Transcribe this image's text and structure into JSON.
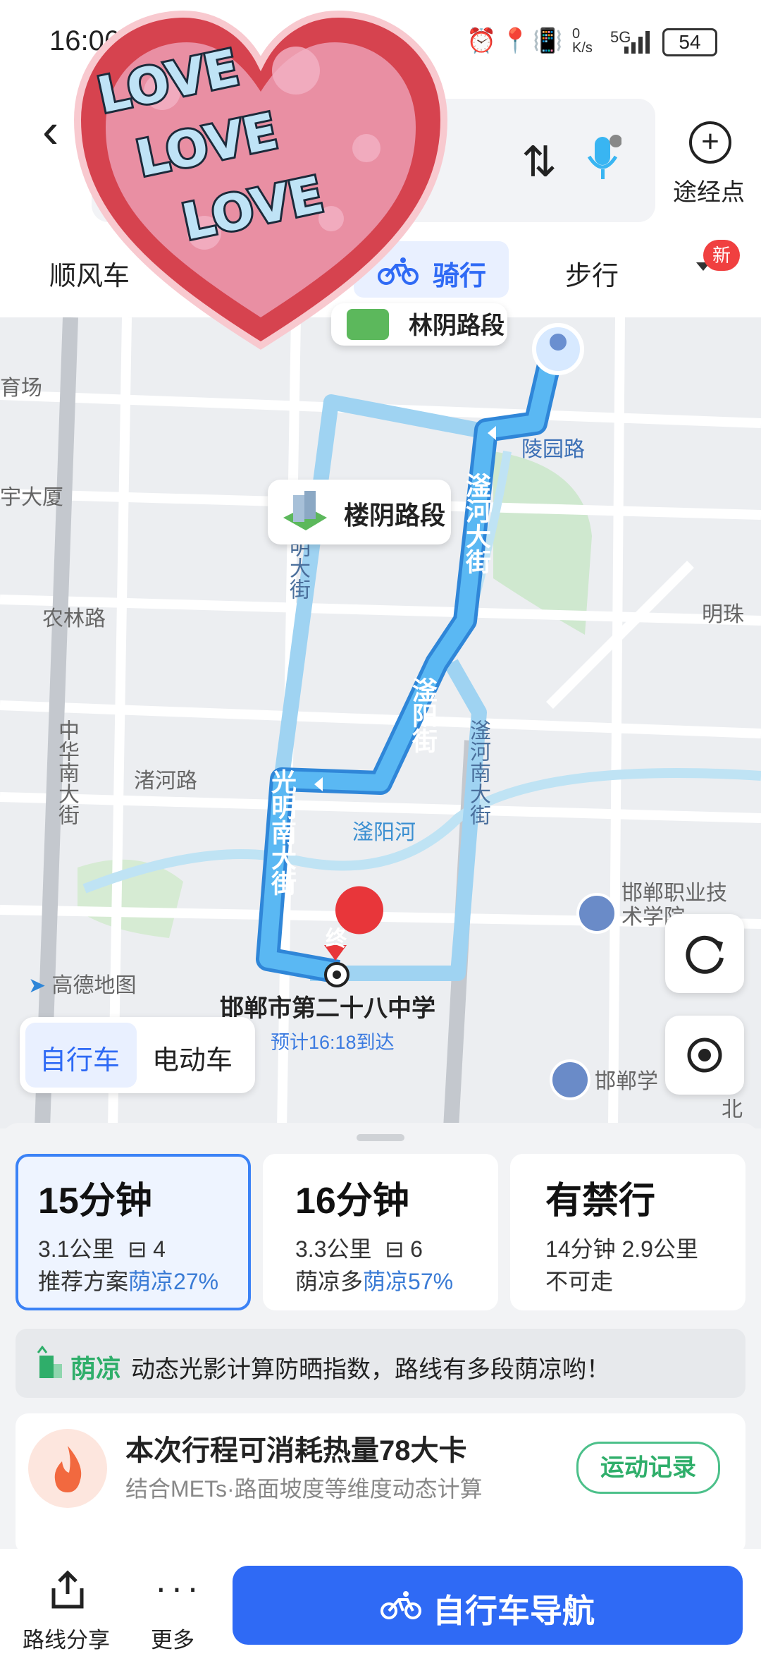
{
  "status_bar": {
    "time": "16:06",
    "network_speed": "0\nK/s",
    "network": "5G",
    "battery": "54"
  },
  "header": {
    "waypoint_label": "途经点",
    "modes": [
      {
        "label": "顺风车"
      },
      {
        "label": "骑行",
        "active": true
      },
      {
        "label": "步行"
      }
    ],
    "badge": "新"
  },
  "map": {
    "shade_label_1": "楼阴路段",
    "shade_label_2": "林阴路段",
    "streets": {
      "lingyuan": "陵园路",
      "fuhe": "滏河大街",
      "fuyang": "滏阳街",
      "fuhe_south": "滏河南大街",
      "guangming_south": "光明南大街",
      "guangming": "明大街",
      "nonglin": "农林路",
      "zhuhe": "渚河路",
      "zhonghua": "中华南大街",
      "fuyang_river": "滏阳河",
      "mingzhu": "明珠",
      "yuchang": "育场",
      "yudasha": "宇大厦",
      "vocational": "邯郸职业技术学院",
      "handan_school": "邯郸学",
      "beibao": "北堡"
    },
    "destination_marker": "终",
    "destination_name": "邯郸市第二十八中学",
    "eta": "预计16:18到达",
    "logo": "高德地图",
    "vehicle": {
      "bike": "自行车",
      "ebike": "电动车"
    }
  },
  "routes": [
    {
      "time": "15分钟",
      "line1": "3.1公里",
      "lights": "4",
      "line2_prefix": "推荐方案",
      "line2_shade": "荫凉27%",
      "selected": true
    },
    {
      "time": "16分钟",
      "line1": "3.3公里",
      "lights": "6",
      "line2_prefix": "荫凉多",
      "line2_shade": "荫凉57%",
      "selected": false
    },
    {
      "time": "有禁行",
      "line1": "14分钟 2.9公里",
      "line2_prefix": "不可走",
      "selected": false
    }
  ],
  "shade_info": {
    "tag": "荫凉",
    "text": "动态光影计算防晒指数，路线有多段荫凉哟！"
  },
  "calorie": {
    "title": "本次行程可消耗热量78大卡",
    "subtitle": "结合METs·路面坡度等维度动态计算",
    "button": "运动记录"
  },
  "bottom": {
    "share": "路线分享",
    "more": "更多",
    "navigate": "自行车导航"
  },
  "sticker": {
    "lines": [
      "LOVE",
      "LOVE",
      "LOVE"
    ]
  },
  "colors": {
    "accent": "#2f6af5",
    "route": "#3fa0e8",
    "shade": "#2fae6a"
  }
}
